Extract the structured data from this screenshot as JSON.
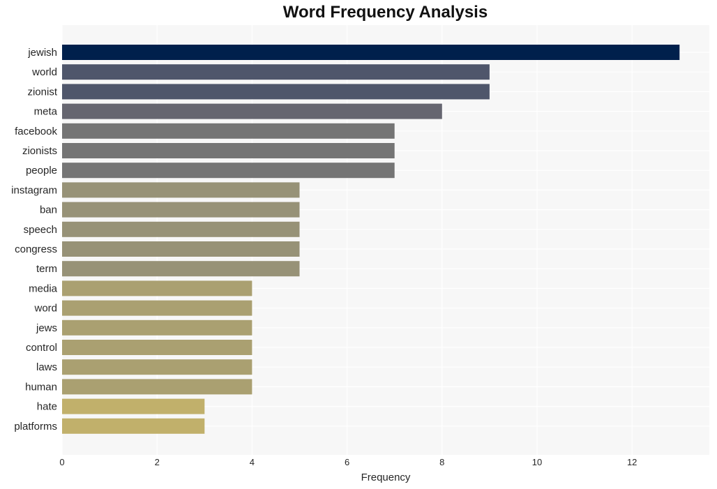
{
  "chart_data": {
    "type": "bar",
    "orientation": "horizontal",
    "title": "Word Frequency Analysis",
    "xlabel": "Frequency",
    "ylabel": "",
    "xlim": [
      0,
      13.65
    ],
    "xticks": [
      0,
      2,
      4,
      6,
      8,
      10,
      12
    ],
    "grid": true,
    "categories": [
      "jewish",
      "world",
      "zionist",
      "meta",
      "facebook",
      "zionists",
      "people",
      "instagram",
      "ban",
      "speech",
      "congress",
      "term",
      "media",
      "word",
      "jews",
      "control",
      "laws",
      "human",
      "hate",
      "platforms"
    ],
    "values": [
      13,
      9,
      9,
      8,
      7,
      7,
      7,
      5,
      5,
      5,
      5,
      5,
      4,
      4,
      4,
      4,
      4,
      4,
      3,
      3
    ],
    "colors": [
      "#00204c",
      "#4f566b",
      "#4f566b",
      "#666670",
      "#757575",
      "#757575",
      "#757575",
      "#979277",
      "#979277",
      "#979277",
      "#979277",
      "#979277",
      "#aaa071",
      "#aaa071",
      "#aaa071",
      "#aaa071",
      "#aaa071",
      "#aaa071",
      "#c1b06b",
      "#c1b06b"
    ]
  }
}
